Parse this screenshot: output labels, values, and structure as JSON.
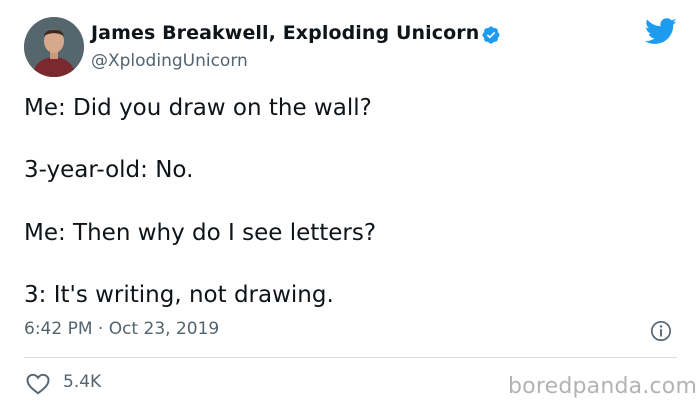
{
  "tweet": {
    "author": {
      "display_name": "James Breakwell, Exploding Unicorn",
      "handle": "@XplodingUnicorn",
      "verified": true
    },
    "lines": [
      "Me: Did you draw on the wall?",
      "3-year-old: No.",
      "Me: Then why do I see letters?",
      "3: It's writing, not drawing."
    ],
    "timestamp": "6:42 PM · Oct 23, 2019",
    "likes": "5.4K"
  },
  "watermark": "boredpanda.com",
  "colors": {
    "twitter_blue": "#1d9bf0",
    "secondary_text": "#536471",
    "divider": "#d6dce0"
  },
  "icons": [
    "avatar",
    "verified-badge-icon",
    "twitter-bird-icon",
    "info-icon",
    "heart-icon"
  ]
}
